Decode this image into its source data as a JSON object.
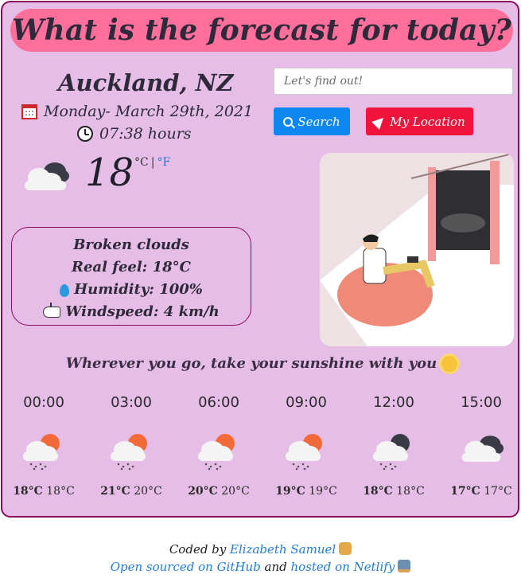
{
  "header": {
    "title": "What is the forecast for today?"
  },
  "current": {
    "city": "Auckland, NZ",
    "date": "Monday- March 29th, 2021",
    "time": "07:38 hours",
    "icon": "broken-clouds-icon",
    "temperature": "18",
    "unit_c": "°C",
    "unit_sep": "|",
    "unit_f": "°F",
    "description": "Broken clouds",
    "real_feel": "Real feel: 18°C",
    "humidity": "Humidity: 100%",
    "windspeed": "Windspeed: 4 km/h"
  },
  "search": {
    "placeholder": "Let's find out!",
    "value": "",
    "search_label": "Search",
    "location_label": "My Location"
  },
  "quote": "Wherever you go, take your sunshine with you",
  "forecast": [
    {
      "time": "00:00",
      "hi": "18°C",
      "lo": "18°C",
      "icon": "rain-sun-cloud-icon"
    },
    {
      "time": "03:00",
      "hi": "21°C",
      "lo": "20°C",
      "icon": "rain-sun-cloud-icon"
    },
    {
      "time": "06:00",
      "hi": "20°C",
      "lo": "20°C",
      "icon": "rain-sun-cloud-icon"
    },
    {
      "time": "09:00",
      "hi": "19°C",
      "lo": "19°C",
      "icon": "rain-sun-cloud-icon"
    },
    {
      "time": "12:00",
      "hi": "18°C",
      "lo": "18°C",
      "icon": "rain-night-cloud-icon"
    },
    {
      "time": "15:00",
      "hi": "17°C",
      "lo": "17°C",
      "icon": "broken-clouds-icon"
    }
  ],
  "footer": {
    "coded_by": "Coded by",
    "author": "Elizabeth Samuel",
    "open_sourced": "Open sourced on GitHub",
    "and": "and",
    "hosted": "hosted on Netlify"
  },
  "colors": {
    "background": "#e6bde6",
    "title_pill": "#ff6f9c",
    "border": "#8a0a5e",
    "search_button": "#0d87f1",
    "location_button": "#f0143c",
    "link": "#1e7bd8"
  }
}
